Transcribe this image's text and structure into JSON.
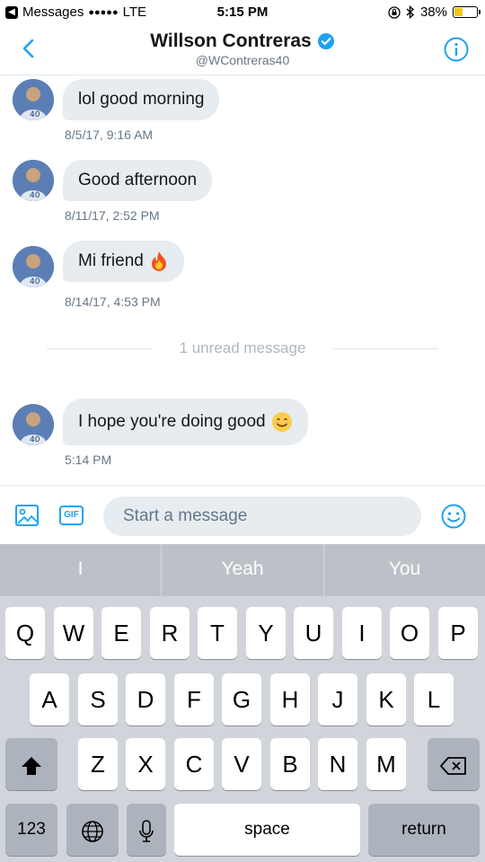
{
  "status_bar": {
    "carrier": "Messages",
    "signal": "●●●●●",
    "network": "LTE",
    "time": "5:15 PM",
    "battery": "38%",
    "battery_level": 0.38
  },
  "header": {
    "name": "Willson Contreras",
    "handle": "@WContreras40"
  },
  "messages": [
    {
      "text": "lol good morning",
      "time": "8/5/17, 9:16 AM"
    },
    {
      "text": "Good afternoon",
      "time": "8/11/17, 2:52 PM"
    },
    {
      "text": "Mi friend",
      "emoji": "fire-emoji",
      "time": "8/14/17, 4:53 PM"
    },
    {
      "text": "I hope you're doing good",
      "emoji": "smile-emoji",
      "time": "5:14 PM"
    }
  ],
  "unread_label": "1 unread message",
  "compose": {
    "gif_label": "GIF",
    "placeholder": "Start a message"
  },
  "keyboard": {
    "suggestions": [
      "I",
      "Yeah",
      "You"
    ],
    "row1": [
      "Q",
      "W",
      "E",
      "R",
      "T",
      "Y",
      "U",
      "I",
      "O",
      "P"
    ],
    "row2": [
      "A",
      "S",
      "D",
      "F",
      "G",
      "H",
      "J",
      "K",
      "L"
    ],
    "row3": [
      "Z",
      "X",
      "C",
      "V",
      "B",
      "N",
      "M"
    ],
    "numbers_label": "123",
    "space_label": "space",
    "return_label": "return"
  },
  "colors": {
    "accent": "#1da1f2",
    "bubble": "#e6ecf0",
    "muted_text": "#657786"
  }
}
